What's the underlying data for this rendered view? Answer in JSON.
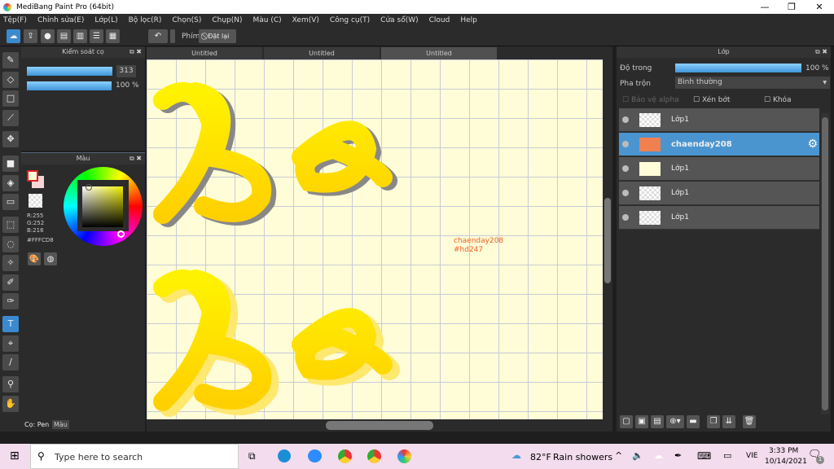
{
  "window": {
    "title": "MediBang Paint Pro (64bit)",
    "min": "—",
    "max": "❐",
    "close": "✕"
  },
  "menu": [
    "Tệp(F)",
    "Chỉnh sửa(E)",
    "Lớp(L)",
    "Bộ lọc(R)",
    "Chọn(S)",
    "Chụp(N)",
    "Màu (C)",
    "Xem(V)",
    "Công cụ(T)",
    "Cửa sổ(W)",
    "Cloud",
    "Help"
  ],
  "toolbar": {
    "key_label": "Phím",
    "reset_label": "Đặt lại"
  },
  "brush_panel": {
    "title": "Kiểm soát cọ",
    "size": "313",
    "opacity": "100 %"
  },
  "color_panel": {
    "title": "Màu",
    "r": "R:255",
    "g": "G:252",
    "b": "B:216",
    "hex": "#FFFCD8",
    "fg_color": "#fffcd8",
    "bg_color": "#f5d5d5"
  },
  "bottom_tabs": [
    "Cọ: Pen",
    "Màu"
  ],
  "canvas_tabs": [
    "Untitled",
    "Untitled",
    "Untitled"
  ],
  "canvas": {
    "text_lines": [
      "chaenday208",
      "#hd247"
    ],
    "text_color": "#f06020",
    "art_color": "#ffee00"
  },
  "layer_panel": {
    "title": "Lớp",
    "opacity_label": "Độ trong",
    "opacity_value": "100 %",
    "opacity": 100,
    "blend_label": "Pha trộn",
    "blend_value": "Bình thường",
    "protect_alpha": "Bảo vệ alpha",
    "clip": "Xén bớt",
    "lock": "Khóa",
    "layers": [
      {
        "name": "Lớp1",
        "selected": false
      },
      {
        "name": "chaenday208",
        "selected": true
      },
      {
        "name": "Lớp1",
        "selected": false
      },
      {
        "name": "Lớp1",
        "selected": false
      },
      {
        "name": "Lớp1",
        "selected": false
      }
    ]
  },
  "taskbar": {
    "search_placeholder": "Type here to search",
    "weather": "82°F",
    "weather_desc": "Rain showers",
    "lang": "VIE",
    "time": "3:33 PM",
    "date": "10/14/2021",
    "notif_count": "1"
  }
}
